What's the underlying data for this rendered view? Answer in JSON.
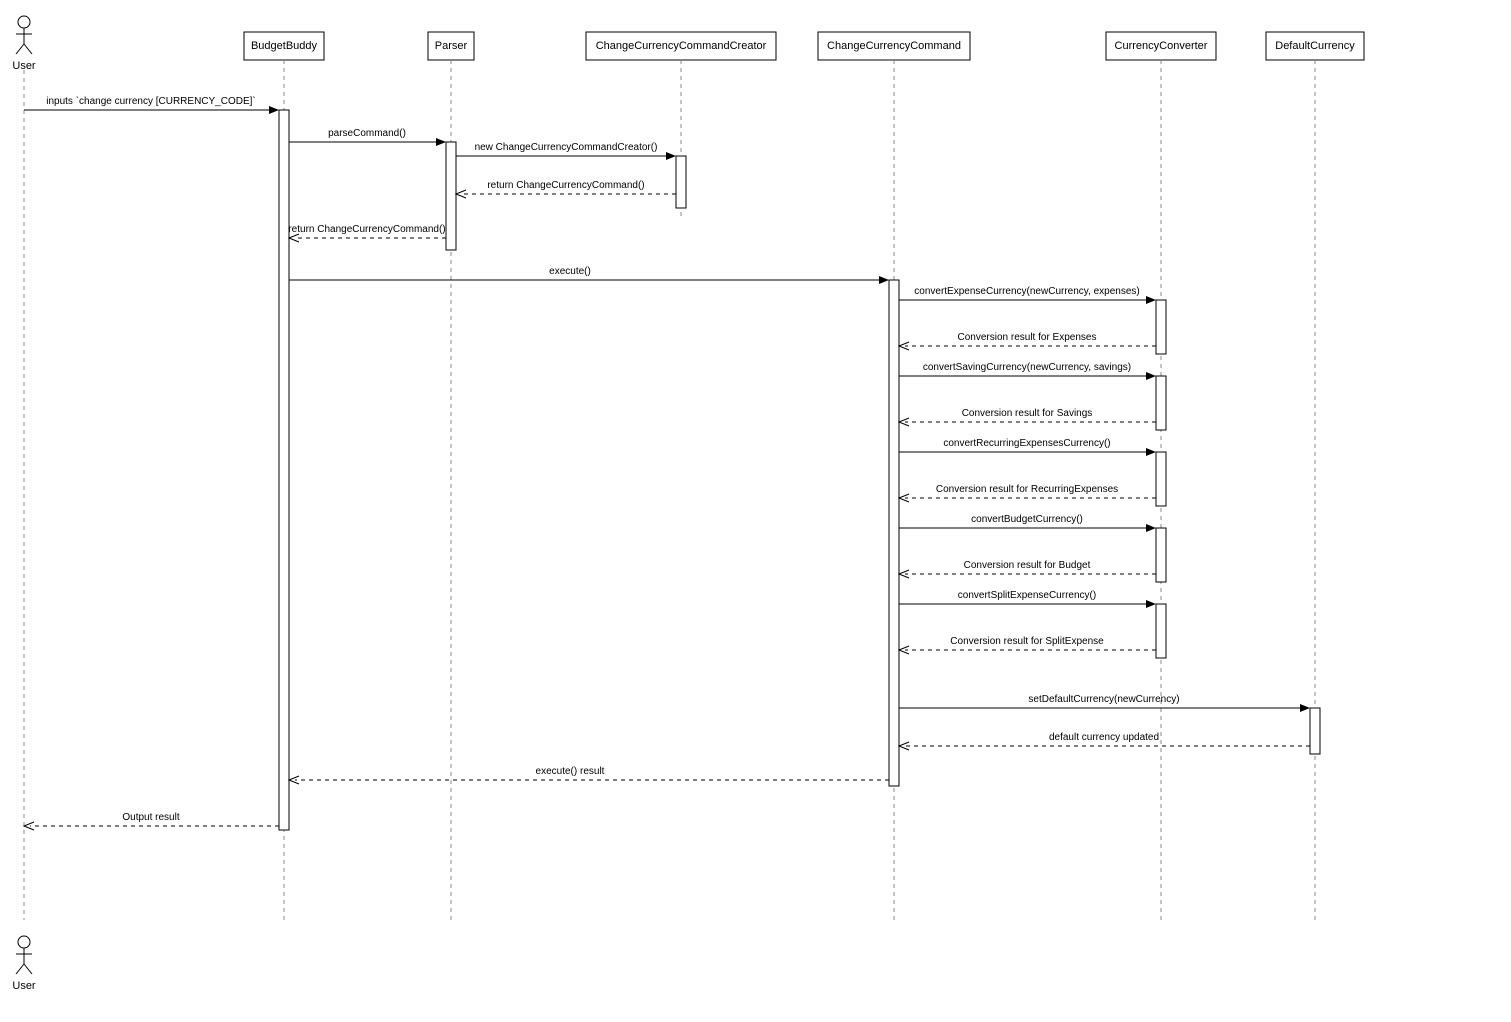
{
  "participants": {
    "user_top": "User",
    "user_bottom": "User",
    "budgetbuddy": "BudgetBuddy",
    "parser": "Parser",
    "creator": "ChangeCurrencyCommandCreator",
    "command": "ChangeCurrencyCommand",
    "converter": "CurrencyConverter",
    "defaultcurrency": "DefaultCurrency"
  },
  "messages": {
    "m1": "inputs `change currency [CURRENCY_CODE]`",
    "m2": "parseCommand()",
    "m3": "new ChangeCurrencyCommandCreator()",
    "m4": "return ChangeCurrencyCommand()",
    "m5": "return ChangeCurrencyCommand()",
    "m6": "execute()",
    "m7": "convertExpenseCurrency(newCurrency, expenses)",
    "m8": "Conversion result for Expenses",
    "m9": "convertSavingCurrency(newCurrency, savings)",
    "m10": "Conversion result for Savings",
    "m11": "convertRecurringExpensesCurrency()",
    "m12": "Conversion result for RecurringExpenses",
    "m13": "convertBudgetCurrency()",
    "m14": "Conversion result for Budget",
    "m15": "convertSplitExpenseCurrency()",
    "m16": "Conversion result for SplitExpense",
    "m17": "setDefaultCurrency(newCurrency)",
    "m18": "default currency updated",
    "m19": "execute() result",
    "m20": "Output result"
  }
}
